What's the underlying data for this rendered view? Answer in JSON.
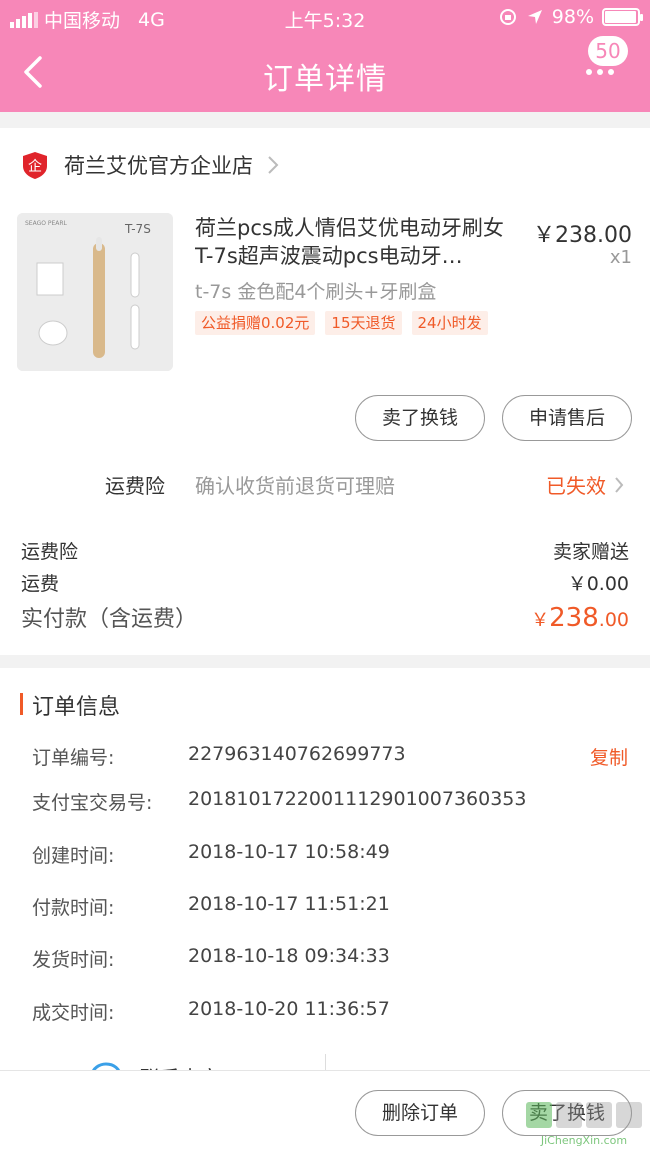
{
  "status_bar": {
    "carrier": "中国移动",
    "network": "4G",
    "time": "上午5:32",
    "battery": "98%",
    "battery_level": 0.98
  },
  "navbar": {
    "title": "订单详情",
    "badge": "50"
  },
  "shop": {
    "name": "荷兰艾优官方企业店"
  },
  "product": {
    "title": "荷兰pcs成人情侣艾优电动牙刷女 T-7s超声波震动pcs电动牙…",
    "price": "￥238.00",
    "quantity": "x1",
    "sku": "t-7s 金色配4个刷头+牙刷盒",
    "tags": [
      "公益捐赠0.02元",
      "15天退货",
      "24小时发"
    ],
    "image_label": "T-7S"
  },
  "actions": {
    "sell_exchange": "卖了换钱",
    "apply_aftersale": "申请售后"
  },
  "insurance": {
    "label": "运费险",
    "desc": "确认收货前退货可理赔",
    "status": "已失效"
  },
  "fees": {
    "insurance_label": "运费险",
    "insurance_value": "卖家赠送",
    "shipping_label": "运费",
    "shipping_value": "￥0.00",
    "total_label": "实付款（含运费）",
    "total_currency": "￥",
    "total_int": "238",
    "total_dec": ".00"
  },
  "order_info": {
    "title": "订单信息",
    "copy_label": "复制",
    "rows": [
      {
        "key": "订单编号:",
        "value": "227963140762699773"
      },
      {
        "key": "支付宝交易号:",
        "value": "2018101722001112901007360353"
      },
      {
        "key": "创建时间:",
        "value": "2018-10-17 10:58:49"
      },
      {
        "key": "付款时间:",
        "value": "2018-10-17 11:51:21"
      },
      {
        "key": "发货时间:",
        "value": "2018-10-18 09:34:33"
      },
      {
        "key": "成交时间:",
        "value": "2018-10-20 11:36:57"
      }
    ]
  },
  "contact": {
    "label": "联系卖家"
  },
  "bottom": {
    "delete_order": "删除订单",
    "sell_exchange": "卖了换钱"
  },
  "watermark": {
    "text": "JiChengXin.com"
  },
  "colors": {
    "brand_pink": "#f787b8",
    "accent_orange": "#f05a28"
  }
}
